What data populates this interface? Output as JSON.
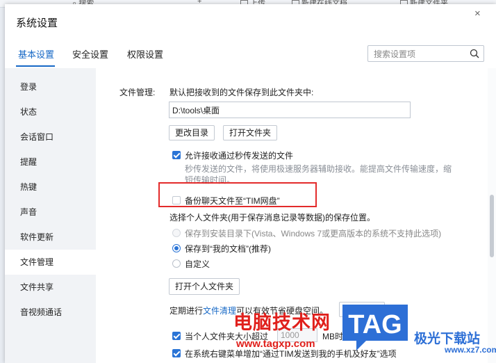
{
  "background": {
    "search_label": "搜索",
    "plus": "+",
    "upload_label": "上传",
    "new_online_doc": "新建在线文档",
    "new_file": "新建文件夹"
  },
  "window": {
    "title": "系统设置",
    "close_glyph": "×"
  },
  "tabs": [
    {
      "label": "基本设置",
      "active": true
    },
    {
      "label": "安全设置",
      "active": false
    },
    {
      "label": "权限设置",
      "active": false
    }
  ],
  "search": {
    "placeholder": "搜索设置项",
    "icon": "search-icon"
  },
  "sidebar": {
    "items": [
      {
        "label": "登录"
      },
      {
        "label": "状态"
      },
      {
        "label": "会话窗口"
      },
      {
        "label": "提醒"
      },
      {
        "label": "热键"
      },
      {
        "label": "声音"
      },
      {
        "label": "软件更新"
      },
      {
        "label": "文件管理",
        "active": true
      },
      {
        "label": "文件共享"
      },
      {
        "label": "音视频通话"
      }
    ]
  },
  "file_management": {
    "section_label": "文件管理:",
    "save_desc": "默认把接收到的文件保存到此文件夹中:",
    "path_value": "D:\\tools\\桌面",
    "change_dir_button": "更改目录",
    "open_folder_button": "打开文件夹",
    "allow_second_transfer": {
      "label": "允许接收通过秒传发送的文件",
      "checked": true
    },
    "second_transfer_desc": "秒传发送的文件，将使用极速服务器辅助接收。能提高文件传输速度，缩短传输时间。",
    "backup_chat": {
      "label": "备份聊天文件至“TIM网盘”",
      "checked": false
    },
    "personal_folder_desc": "选择个人文件夹(用于保存消息记录等数据)的保存位置。",
    "radio_options": [
      {
        "label": "保存到安装目录下(Vista、Windows 7或更高版本的系统不支持此选项)",
        "state": "disabled"
      },
      {
        "label": "保存到“我的文档”(推荐)",
        "state": "selected"
      },
      {
        "label": "自定义",
        "state": "unselected"
      }
    ],
    "open_personal_folder_button": "打开个人文件夹",
    "cleanup_prefix": "定期进行",
    "cleanup_link": "文件清理",
    "cleanup_suffix": "可以有效节省硬盘空间。",
    "cleanup_button": "前去清理",
    "size_limit": {
      "label": "当个人文件夹大小超过",
      "value": "1000",
      "unit": "MB时，提醒我清理",
      "checked": true
    },
    "context_menu": {
      "label": "在系统右键菜单增加“通过TIM发送到我的手机及好友”选项",
      "checked": true
    }
  },
  "watermark": {
    "cn_text": "电脑技术网",
    "url": "www.tagxp.com",
    "logo_text": "TAG",
    "right_text": "极光下载站",
    "right_url": "www.xz7.com"
  },
  "colors": {
    "accent": "#1668c6",
    "checkbox": "#2a74d6",
    "highlight": "#e32a2a",
    "watermark_red": "#e0201c",
    "logo_blue": "#2d6fd6"
  }
}
